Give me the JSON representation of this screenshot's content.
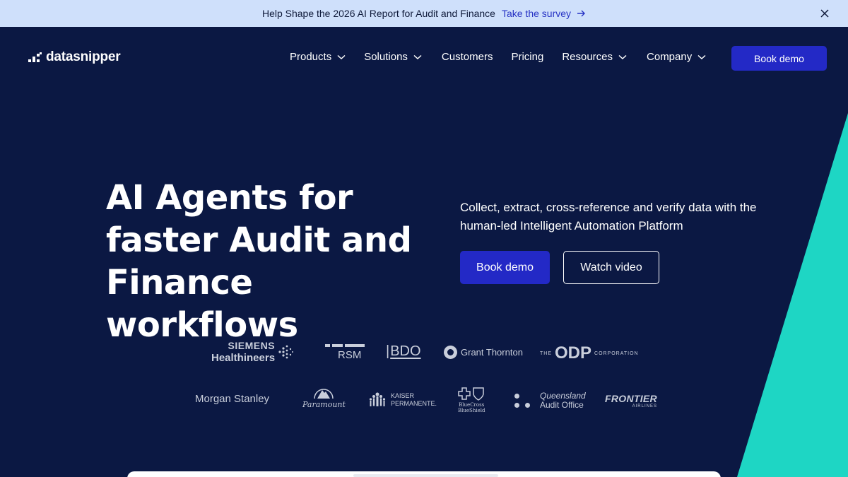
{
  "announcement": {
    "message": "Help Shape the 2026 AI Report for Audit and Finance",
    "link_label": "Take the survey",
    "icons": [
      "arrow-right-icon",
      "close-icon"
    ]
  },
  "nav": {
    "logo_text": "datasnipper",
    "items": [
      {
        "label": "Products",
        "has_dropdown": true
      },
      {
        "label": "Solutions",
        "has_dropdown": true
      },
      {
        "label": "Customers",
        "has_dropdown": false
      },
      {
        "label": "Pricing",
        "has_dropdown": false
      },
      {
        "label": "Resources",
        "has_dropdown": true
      },
      {
        "label": "Company",
        "has_dropdown": true
      }
    ],
    "cta_label": "Book demo"
  },
  "hero": {
    "title_lines": [
      "AI Agents for",
      "faster Audit and",
      "Finance workflows"
    ],
    "subtitle": "Collect, extract, cross-reference and verify data with the human-led Intelligent Automation Platform",
    "primary_button": "Book demo",
    "secondary_button": "Watch video"
  },
  "customer_logos": {
    "siemens_line1": "SIEMENS",
    "siemens_line2": "Healthineers",
    "rsm": "RSM",
    "bdo": "BDO",
    "grant_thornton": "Grant Thornton",
    "odp_prefix": "THE",
    "odp": "ODP",
    "odp_suffix": "CORPORATION",
    "morgan_stanley": "Morgan Stanley",
    "paramount": "Paramount",
    "kaiser_line1": "KAISER",
    "kaiser_line2": "PERMANENTE.",
    "bluecross_line1": "BlueCross",
    "bluecross_line2": "BlueShield",
    "queensland_line1": "Queensland",
    "queensland_line2": "Audit Office",
    "frontier_line1": "FRONTIER",
    "frontier_line2": "AIRLINES"
  },
  "colors": {
    "background": "#0b1843",
    "announcement_bg": "#cfe0fb",
    "accent_button": "#2329c6",
    "teal": "#1ed6c4",
    "logo_gray": "#c9cedb"
  }
}
